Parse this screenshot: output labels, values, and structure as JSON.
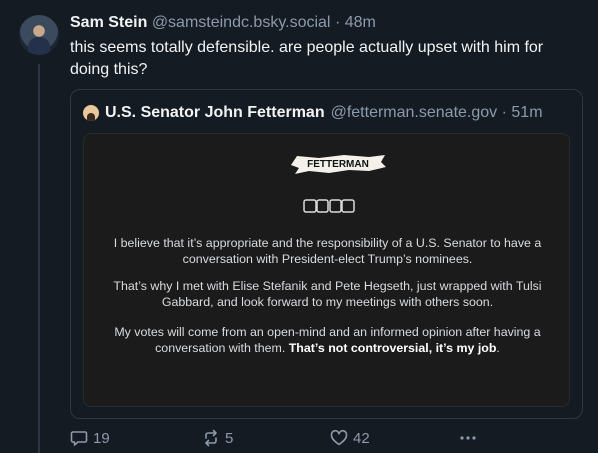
{
  "post": {
    "author_name": "Sam Stein",
    "author_handle": "@samsteindc.bsky.social",
    "separator": "·",
    "time": "48m",
    "text": "this seems totally defensible. are people actually upset with him for doing this?"
  },
  "quote": {
    "author_name": "U.S. Senator John Fetterman",
    "author_handle": "@fetterman.senate.gov",
    "separator": "·",
    "time": "51m",
    "image": {
      "logo_text": "FETTERMAN",
      "paragraph_1": "I believe that it’s appropriate and the responsibility of a U.S. Senator to have a conversation with President-elect Trump’s nominees.",
      "paragraph_2": "That’s why I met with Elise Stefanik and Pete Hegseth, just wrapped with Tulsi Gabbard, and look forward to my meetings with others soon.",
      "paragraph_3_plain": "My votes will come from an open-mind and an informed opinion after having a conversation with them. ",
      "paragraph_3_bold": "That’s not controversial, it’s my job",
      "paragraph_3_end": "."
    }
  },
  "actions": {
    "reply_count": "19",
    "repost_count": "5",
    "like_count": "42",
    "reply_icon": "speech-bubble-icon",
    "repost_icon": "repost-arrows-icon",
    "like_icon": "heart-icon",
    "more_icon": "ellipsis-icon"
  },
  "colors": {
    "background": "#151b23",
    "muted_text": "#8d9aab",
    "border": "#2e3744",
    "card_background": "#1b1b1b"
  }
}
